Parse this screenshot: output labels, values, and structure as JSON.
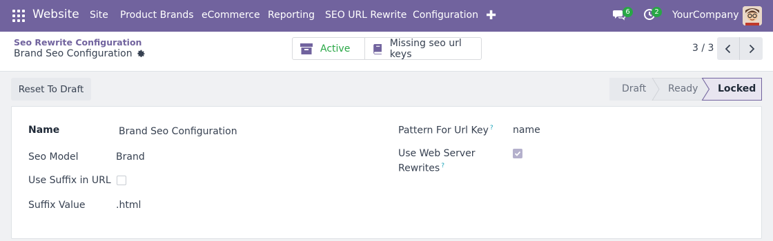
{
  "navbar": {
    "brand": "Website",
    "menu": [
      "Site",
      "Product Brands",
      "eCommerce",
      "Reporting",
      "SEO URL Rewrite",
      "Configuration"
    ],
    "messages_count": "6",
    "activities_count": "2",
    "company": "YourCompany"
  },
  "breadcrumb": {
    "parent": "Seo Rewrite Configuration",
    "current": "Brand Seo Configuration"
  },
  "smart_buttons": {
    "active": "Active",
    "missing": "Missing seo url keys"
  },
  "pager": {
    "value": "3 / 3"
  },
  "actions": {
    "reset": "Reset To Draft"
  },
  "statusbar": {
    "stages": [
      "Draft",
      "Ready",
      "Locked"
    ],
    "current": "Locked"
  },
  "form": {
    "name_label": "Name",
    "name_value": "Brand Seo Configuration",
    "model_label": "Seo Model",
    "model_value": "Brand",
    "suffix_label": "Use Suffix in URL",
    "suffix_checked": false,
    "suffix_value_label": "Suffix Value",
    "suffix_value": ".html",
    "pattern_label": "Pattern For Url Key",
    "pattern_value": "name",
    "web_server_label_1": "Use Web Server",
    "web_server_label_2": "Rewrites",
    "web_server_checked": true,
    "help_mark": "?"
  },
  "colors": {
    "navbar": "#71639e",
    "active_green": "#28a745",
    "help": "#17a2b8"
  }
}
